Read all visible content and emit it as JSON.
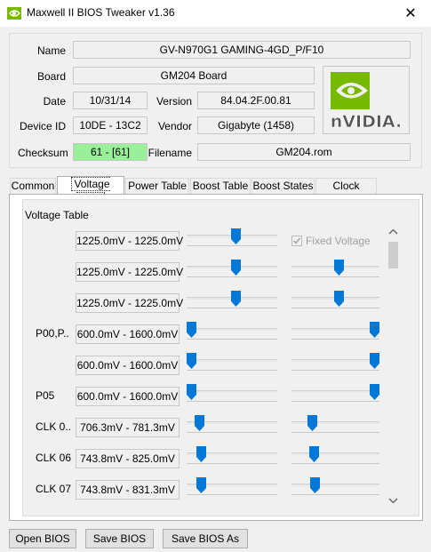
{
  "window": {
    "title": "Maxwell II BIOS Tweaker v1.36",
    "close_glyph": "✕"
  },
  "info": {
    "name_label": "Name",
    "name_value": "GV-N970G1 GAMING-4GD_P/F10",
    "board_label": "Board",
    "board_value": "GM204 Board",
    "date_label": "Date",
    "date_value": "10/31/14",
    "version_label": "Version",
    "version_value": "84.04.2F.00.81",
    "device_label": "Device ID",
    "device_value": "10DE - 13C2",
    "vendor_label": "Vendor",
    "vendor_value": "Gigabyte (1458)",
    "checksum_label": "Checksum",
    "checksum_value": "61 - [61]",
    "filename_label": "Filename",
    "filename_value": "GM204.rom",
    "logo_text": "nVIDIA."
  },
  "tabs": [
    {
      "label": "Common",
      "active": false
    },
    {
      "label": "Voltage Table",
      "active": true
    },
    {
      "label": "Power Table",
      "active": false
    },
    {
      "label": "Boost Table",
      "active": false
    },
    {
      "label": "Boost States",
      "active": false
    },
    {
      "label": "Clock States",
      "active": false
    }
  ],
  "voltage_table": {
    "group_title": "Voltage Table",
    "fixed_voltage_label": "Fixed Voltage",
    "fixed_voltage_checked": true,
    "rows": [
      {
        "label": "",
        "range": "1225.0mV - 1225.0mV",
        "min_level": 0.55,
        "max_level": null
      },
      {
        "label": "",
        "range": "1225.0mV - 1225.0mV",
        "min_level": 0.55,
        "max_level": 0.55
      },
      {
        "label": "",
        "range": "1225.0mV - 1225.0mV",
        "min_level": 0.55,
        "max_level": 0.55
      },
      {
        "label": "P00,P..",
        "range": "600.0mV - 1600.0mV",
        "min_level": 0.0,
        "max_level": 1.0
      },
      {
        "label": "",
        "range": "600.0mV - 1600.0mV",
        "min_level": 0.0,
        "max_level": 1.0
      },
      {
        "label": "P05",
        "range": "600.0mV - 1600.0mV",
        "min_level": 0.0,
        "max_level": 1.0
      },
      {
        "label": "CLK 0..",
        "range": "706.3mV - 781.3mV",
        "min_level": 0.1,
        "max_level": 0.2
      },
      {
        "label": "CLK 06",
        "range": "743.8mV - 825.0mV",
        "min_level": 0.12,
        "max_level": 0.23
      },
      {
        "label": "CLK 07",
        "range": "743.8mV - 831.3mV",
        "min_level": 0.12,
        "max_level": 0.24
      }
    ]
  },
  "buttons": {
    "open": "Open BIOS",
    "save": "Save BIOS",
    "save_as": "Save BIOS As"
  },
  "colors": {
    "accent": "#0078d7",
    "checksum_ok": "#98f098",
    "nvidia_green": "#76b900"
  }
}
